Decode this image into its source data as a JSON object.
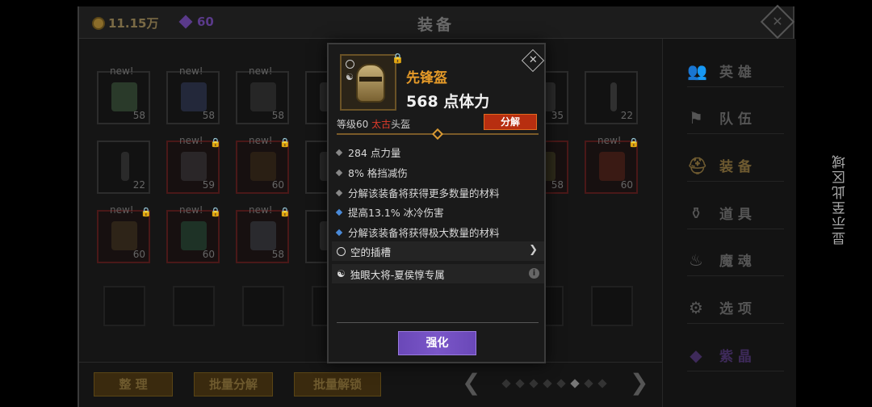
{
  "top": {
    "gold": "11.15万",
    "gems": "60",
    "title": "装备"
  },
  "inventory": {
    "slots": [
      {
        "new": "new!",
        "level": "58"
      },
      {
        "new": "new!",
        "level": "58"
      },
      {
        "new": "new!",
        "level": "58"
      },
      {
        "new": "",
        "level": "35"
      },
      {
        "new": "",
        "level": "22"
      },
      {
        "new": "",
        "level": "22"
      },
      {
        "new": "new!",
        "level": "59"
      },
      {
        "new": "new!",
        "level": "60"
      },
      {
        "new": "",
        "level": "58"
      },
      {
        "new": "new!",
        "level": "60"
      },
      {
        "new": "new!",
        "level": "60"
      },
      {
        "new": "new!",
        "level": "60"
      },
      {
        "new": "new!",
        "level": "58"
      }
    ]
  },
  "bottom": {
    "sort": "整 理",
    "batch_decompose": "批量分解",
    "batch_unlock": "批量解锁",
    "prev": "❮",
    "next": "❯"
  },
  "menu": {
    "items": [
      {
        "label": "英 雄",
        "icon": "people-icon",
        "glyph": "👥"
      },
      {
        "label": "队 伍",
        "icon": "flag-icon",
        "glyph": "⚑"
      },
      {
        "label": "装 备",
        "icon": "helmet-icon",
        "glyph": "⛑"
      },
      {
        "label": "道 具",
        "icon": "bag-icon",
        "glyph": "⚱"
      },
      {
        "label": "魔 魂",
        "icon": "flame-icon",
        "glyph": "♨"
      },
      {
        "label": "选 项",
        "icon": "gear-icon",
        "glyph": "⚙"
      },
      {
        "label": "紫 晶",
        "icon": "crystal-icon",
        "glyph": "◆"
      }
    ]
  },
  "side_note": "显示至此区域",
  "popup": {
    "name": "先锋盔",
    "main_stat": "568 点体力",
    "level_prefix": "等级60",
    "quality": "太古",
    "slot_type": "头盔",
    "decompose": "分解",
    "close": "✕",
    "attributes": [
      {
        "text": "284 点力量",
        "color": "gray"
      },
      {
        "text": "8% 格挡减伤",
        "color": "gray"
      },
      {
        "text": "分解该装备将获得更多数量的材料",
        "color": "gray"
      },
      {
        "text": "提高13.1% 冰冷伤害",
        "color": "blue"
      },
      {
        "text": "分解该装备将获得极大数量的材料",
        "color": "blue"
      }
    ],
    "socket": "空的插槽",
    "exclusive": "独眼大将-夏侯惇专属",
    "enhance": "强化"
  },
  "colors": {
    "accent_orange": "#e59a28",
    "quality_red": "#e03a2a",
    "enhance_purple": "#7a56c8",
    "decompose_red": "#b72e10"
  }
}
